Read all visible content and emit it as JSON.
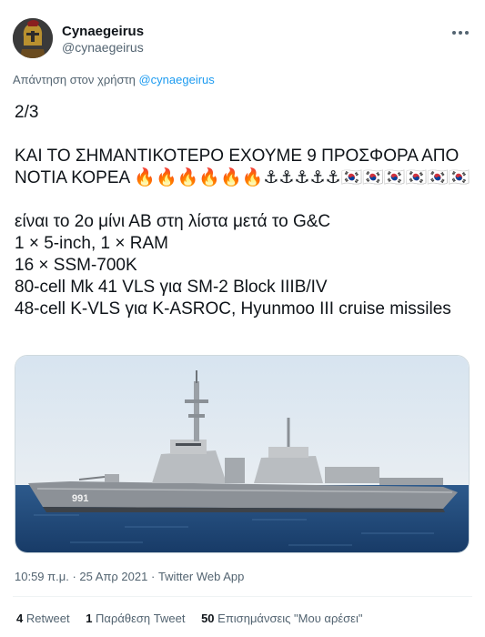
{
  "author": {
    "name": "Cynaegeirus",
    "handle": "@cynaegeirus",
    "avatar_icon": "spartan-warrior-avatar"
  },
  "reply_to": {
    "prefix": "Απάντηση στον χρήστη",
    "mention": "@cynaegeirus"
  },
  "tweet": {
    "text": "2/3\n\nΚΑΙ ΤΟ ΣΗΜΑΝΤΙΚΟΤΕΡΟ ΕΧΟΥΜΕ 9 ΠΡΟΣΦΟΡΑ ΑΠΟ ΝΟΤΙΑ ΚΟΡΕΑ 🔥🔥🔥🔥🔥🔥⚓⚓⚓⚓⚓🇰🇷🇰🇷🇰🇷🇰🇷🇰🇷🇰🇷\n\nείναι το 2ο μίνι ΑΒ στη λίστα μετά το G&C\n1 × 5-inch, 1 × RAM\n16 × SSM-700K\n80-cell Mk 41 VLS για SM-2 Block IIIB/IV\n48-cell K-VLS για K-ASROC, Hyunmoo III cruise missiles"
  },
  "media": {
    "hull_number": "991",
    "alt": "warship-photo"
  },
  "meta": {
    "time": "10:59 π.μ.",
    "sep1": "·",
    "date": "25 Απρ 2021",
    "sep2": "·",
    "client": "Twitter Web App"
  },
  "stats": {
    "retweets": "4",
    "retweets_label": "Retweet",
    "quotes": "1",
    "quotes_label": "Παράθεση Tweet",
    "likes": "50",
    "likes_label": "Επισημάνσεις \"Μου αρέσει\""
  },
  "colors": {
    "accent": "#1d9bf0",
    "secondary_text": "#536471"
  }
}
